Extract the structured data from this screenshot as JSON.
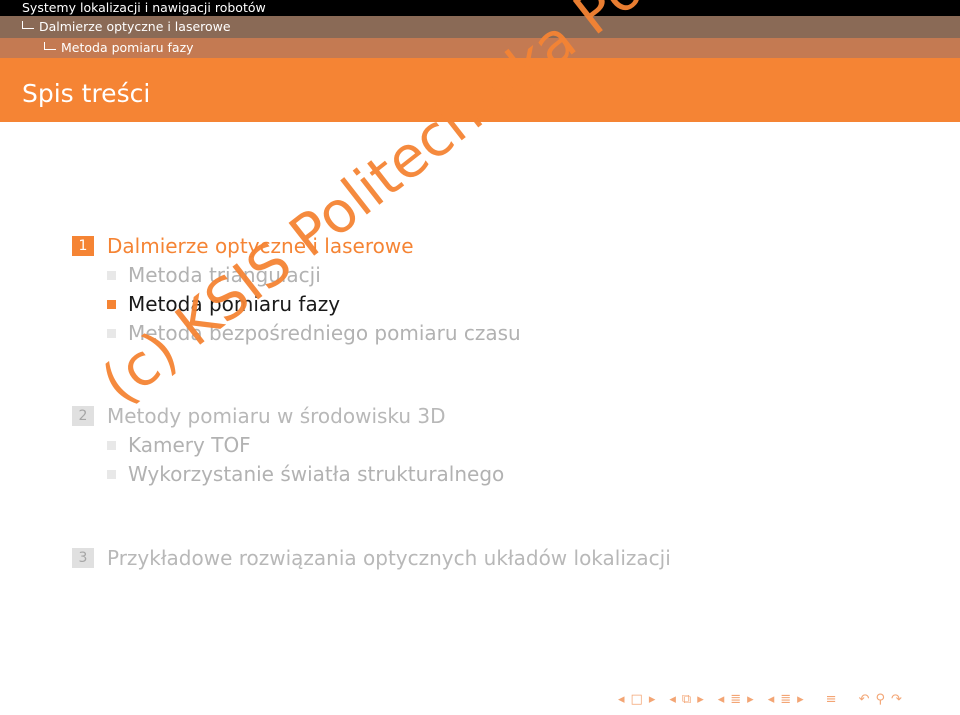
{
  "header": {
    "course": "Systemy lokalizacji i nawigacji robotów",
    "section": "Dalmierze optyczne i laserowe",
    "subsection": "Metoda pomiaru fazy"
  },
  "frame_title": "Spis treści",
  "toc": {
    "sections": [
      {
        "number": "1",
        "title": "Dalmierze optyczne i laserowe",
        "subsections": [
          "Metoda triangulacji",
          "Metoda pomiaru fazy",
          "Metoda bezpośredniego pomiaru czasu"
        ]
      },
      {
        "number": "2",
        "title": "Metody pomiaru w środowisku 3D",
        "subsections": [
          "Kamery TOF",
          "Wykorzystanie światła strukturalnego"
        ]
      },
      {
        "number": "3",
        "title": "Przykładowe rozwiązania optycznych układów lokalizacji",
        "subsections": []
      }
    ]
  },
  "watermark": "(c) KSIS Politechnika Poznanska",
  "nav_icons": [
    "frame-prev-icon",
    "frame-icon",
    "frame-next-icon",
    "subsection-prev-icon",
    "subsection-icon",
    "subsection-next-icon",
    "section-prev-icon",
    "section-icon",
    "section-next-icon",
    "toc-icon",
    "back-icon",
    "search-icon",
    "forward-icon"
  ],
  "colors": {
    "accent": "#f58434",
    "header_black": "#000000",
    "header_section": "#8a6a56",
    "header_subsection": "#c47a52",
    "dimmed_text": "#b2b2b2"
  }
}
